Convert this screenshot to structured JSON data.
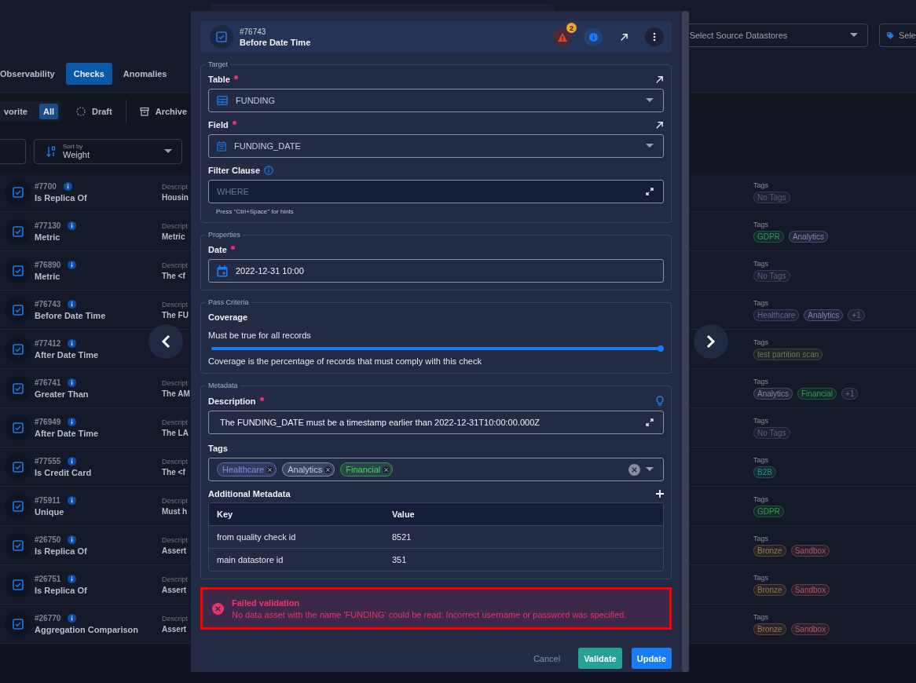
{
  "datastore_select": {
    "placeholder": "Select Source Datastores"
  },
  "tag_select": {
    "placeholder": "Sele"
  },
  "tabs": [
    {
      "label": "Observability",
      "selected": false
    },
    {
      "label": "Checks",
      "selected": true
    },
    {
      "label": "Anomalies",
      "selected": false
    }
  ],
  "filters": [
    {
      "label": "vorite",
      "kind": "plain",
      "selected": false
    },
    {
      "label": "All",
      "kind": "plain",
      "selected": true
    },
    {
      "label": "Draft",
      "kind": "draft",
      "selected": false
    },
    {
      "label": "Archive",
      "kind": "archive",
      "selected": false
    }
  ],
  "sort": {
    "label": "Sort by",
    "value": "Weight"
  },
  "checks": [
    {
      "id": "#7700",
      "name": "Is Replica Of",
      "description_label": "Descript",
      "description": "Housin",
      "tags_label": "Tags",
      "tags": [
        {
          "label": "No Tags",
          "color": "#56607e"
        }
      ]
    },
    {
      "id": "#77130",
      "name": "Metric",
      "description_label": "Descript",
      "description": "Metric",
      "tags_label": "Tags",
      "tags": [
        {
          "label": "GDPR",
          "color": "#2e9e4c"
        },
        {
          "label": "Analytics",
          "color": "#7f87ad"
        }
      ]
    },
    {
      "id": "#76890",
      "name": "Metric",
      "description_label": "Descript",
      "description": "The <f",
      "tags_label": "Tags",
      "tags": [
        {
          "label": "No Tags",
          "color": "#56607e"
        }
      ]
    },
    {
      "id": "#76743",
      "name": "Before Date Time",
      "description_label": "Descript",
      "description": "The FU",
      "tags_label": "Tags",
      "tags": [
        {
          "label": "Healthcare",
          "color": "#5f6a8c"
        },
        {
          "label": "Analytics",
          "color": "#7f87ad"
        },
        {
          "label": "+1",
          "color": "#5f6a8c"
        }
      ]
    },
    {
      "id": "#77412",
      "name": "After Date Time",
      "tags_label": "Tags",
      "tags": [
        {
          "label": "test partition scan",
          "color": "#6a7a4c"
        }
      ]
    },
    {
      "id": "#76741",
      "name": "Greater Than",
      "description_label": "Descript",
      "description": "The AM",
      "tags_label": "Tags",
      "tags": [
        {
          "label": "Analytics",
          "color": "#7f87ad"
        },
        {
          "label": "Financial",
          "color": "#2e9e4c"
        },
        {
          "label": "+1",
          "color": "#5f6a8c"
        }
      ]
    },
    {
      "id": "#76949",
      "name": "After Date Time",
      "description_label": "Descript",
      "description": "The LA",
      "tags_label": "Tags",
      "tags": [
        {
          "label": "No Tags",
          "color": "#56607e"
        }
      ]
    },
    {
      "id": "#77555",
      "name": "Is Credit Card",
      "description_label": "Descript",
      "description": "The <f",
      "tags_label": "Tags",
      "tags": [
        {
          "label": "B2B",
          "color": "#1f958a"
        }
      ]
    },
    {
      "id": "#75911",
      "name": "Unique",
      "description_label": "Descript",
      "description": "Must h",
      "tags_label": "Tags",
      "tags": [
        {
          "label": "GDPR",
          "color": "#2e9e4c"
        }
      ]
    },
    {
      "id": "#26750",
      "name": "Is Replica Of",
      "description_label": "Descript",
      "description": "Assert",
      "tags_label": "Tags",
      "tags": [
        {
          "label": "Bronze",
          "color": "#a8763a"
        },
        {
          "label": "Sandbox",
          "color": "#b85858"
        }
      ]
    },
    {
      "id": "#26751",
      "name": "Is Replica Of",
      "description_label": "Descript",
      "description": "Assert",
      "tags_label": "Tags",
      "tags": [
        {
          "label": "Bronze",
          "color": "#a8763a"
        },
        {
          "label": "Sandbox",
          "color": "#b85858"
        }
      ]
    },
    {
      "id": "#26770",
      "name": "Aggregation Comparison",
      "description_label": "Descript",
      "description": "Assert",
      "tags_label": "Tags",
      "tags": [
        {
          "label": "Bronze",
          "color": "#a8763a"
        },
        {
          "label": "Sandbox",
          "color": "#b85858"
        }
      ]
    }
  ],
  "modal": {
    "id": "#76743",
    "title": "Before Date Time",
    "alert_count": "2",
    "target": {
      "legend": "Target",
      "table": {
        "label": "Table",
        "required": true,
        "value": "FUNDING"
      },
      "field": {
        "label": "Field",
        "required": true,
        "value": "FUNDING_DATE"
      },
      "filter": {
        "label": "Filter Clause",
        "required": false,
        "placeholder": "WHERE",
        "hint": "Press \"Ctrl+Space\" for hints"
      }
    },
    "properties": {
      "legend": "Properties",
      "date": {
        "label": "Date",
        "required": true,
        "value": "2022-12-31 10:00"
      }
    },
    "pass_criteria": {
      "legend": "Pass Criteria",
      "title": "Coverage",
      "caption": "Must be true for all records",
      "level": 1,
      "note": "Coverage is the percentage of records that must comply with this check"
    },
    "metadata": {
      "legend": "Metadata",
      "description": {
        "label": "Description",
        "required": true,
        "value": "The FUNDING_DATE must be a timestamp earlier than 2022-12-31T10:00:00.000Z"
      },
      "tags": {
        "label": "Tags",
        "required": false,
        "items": [
          {
            "label": "Healthcare",
            "color": "#7b8fe0"
          },
          {
            "label": "Analytics",
            "color": "#c3c8ee"
          },
          {
            "label": "Financial",
            "color": "#47d264"
          }
        ]
      },
      "additional": {
        "label": "Additional Metadata",
        "columns": [
          "Key",
          "Value"
        ],
        "rows": [
          [
            "from quality check id",
            "8521"
          ],
          [
            "main datastore id",
            "351"
          ]
        ]
      }
    },
    "error": {
      "title": "Failed validation",
      "message": "No data asset with the name 'FUNDING' could be read: Incorrect username or password was specified."
    },
    "buttons": [
      {
        "label": "Cancel",
        "kind": "text"
      },
      {
        "label": "Validate",
        "kind": "secondary"
      },
      {
        "label": "Update",
        "kind": "primary"
      }
    ]
  }
}
